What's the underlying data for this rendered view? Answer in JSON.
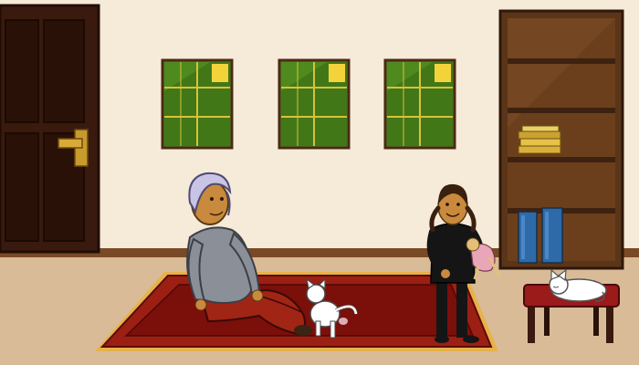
{
  "scene": {
    "kind": "illustrated-room",
    "objects": [
      "door",
      "door-handle",
      "window-left",
      "window-center",
      "window-right",
      "bookshelf",
      "stacked-books",
      "standing-books",
      "rug",
      "grandmother",
      "girl",
      "doll",
      "white-cat",
      "sleeping-cat",
      "footstool"
    ]
  },
  "colors": {
    "wall": "#f6ead8",
    "floor": "#d9bb98",
    "baseboard": "#7a4a26",
    "wood_dark": "#3a1a0e",
    "wood_mid": "#5a3518",
    "window_glass": "#4f8a1f",
    "window_highlight": "#f2d43a",
    "rug_outer": "#9c1f14",
    "rug_inner": "#7b0f0a",
    "rug_fringe": "#e7b24b",
    "grandma_sweater": "#8a8f98",
    "grandma_pants": "#a12515",
    "grandma_hair": "#c9c4e6",
    "girl_outfit": "#151515",
    "skin": "#c98a3e",
    "book_yellow": "#d9b13a",
    "book_blue": "#2f6aa8",
    "stool_seat": "#9b1a1a",
    "cat": "#ffffff"
  }
}
